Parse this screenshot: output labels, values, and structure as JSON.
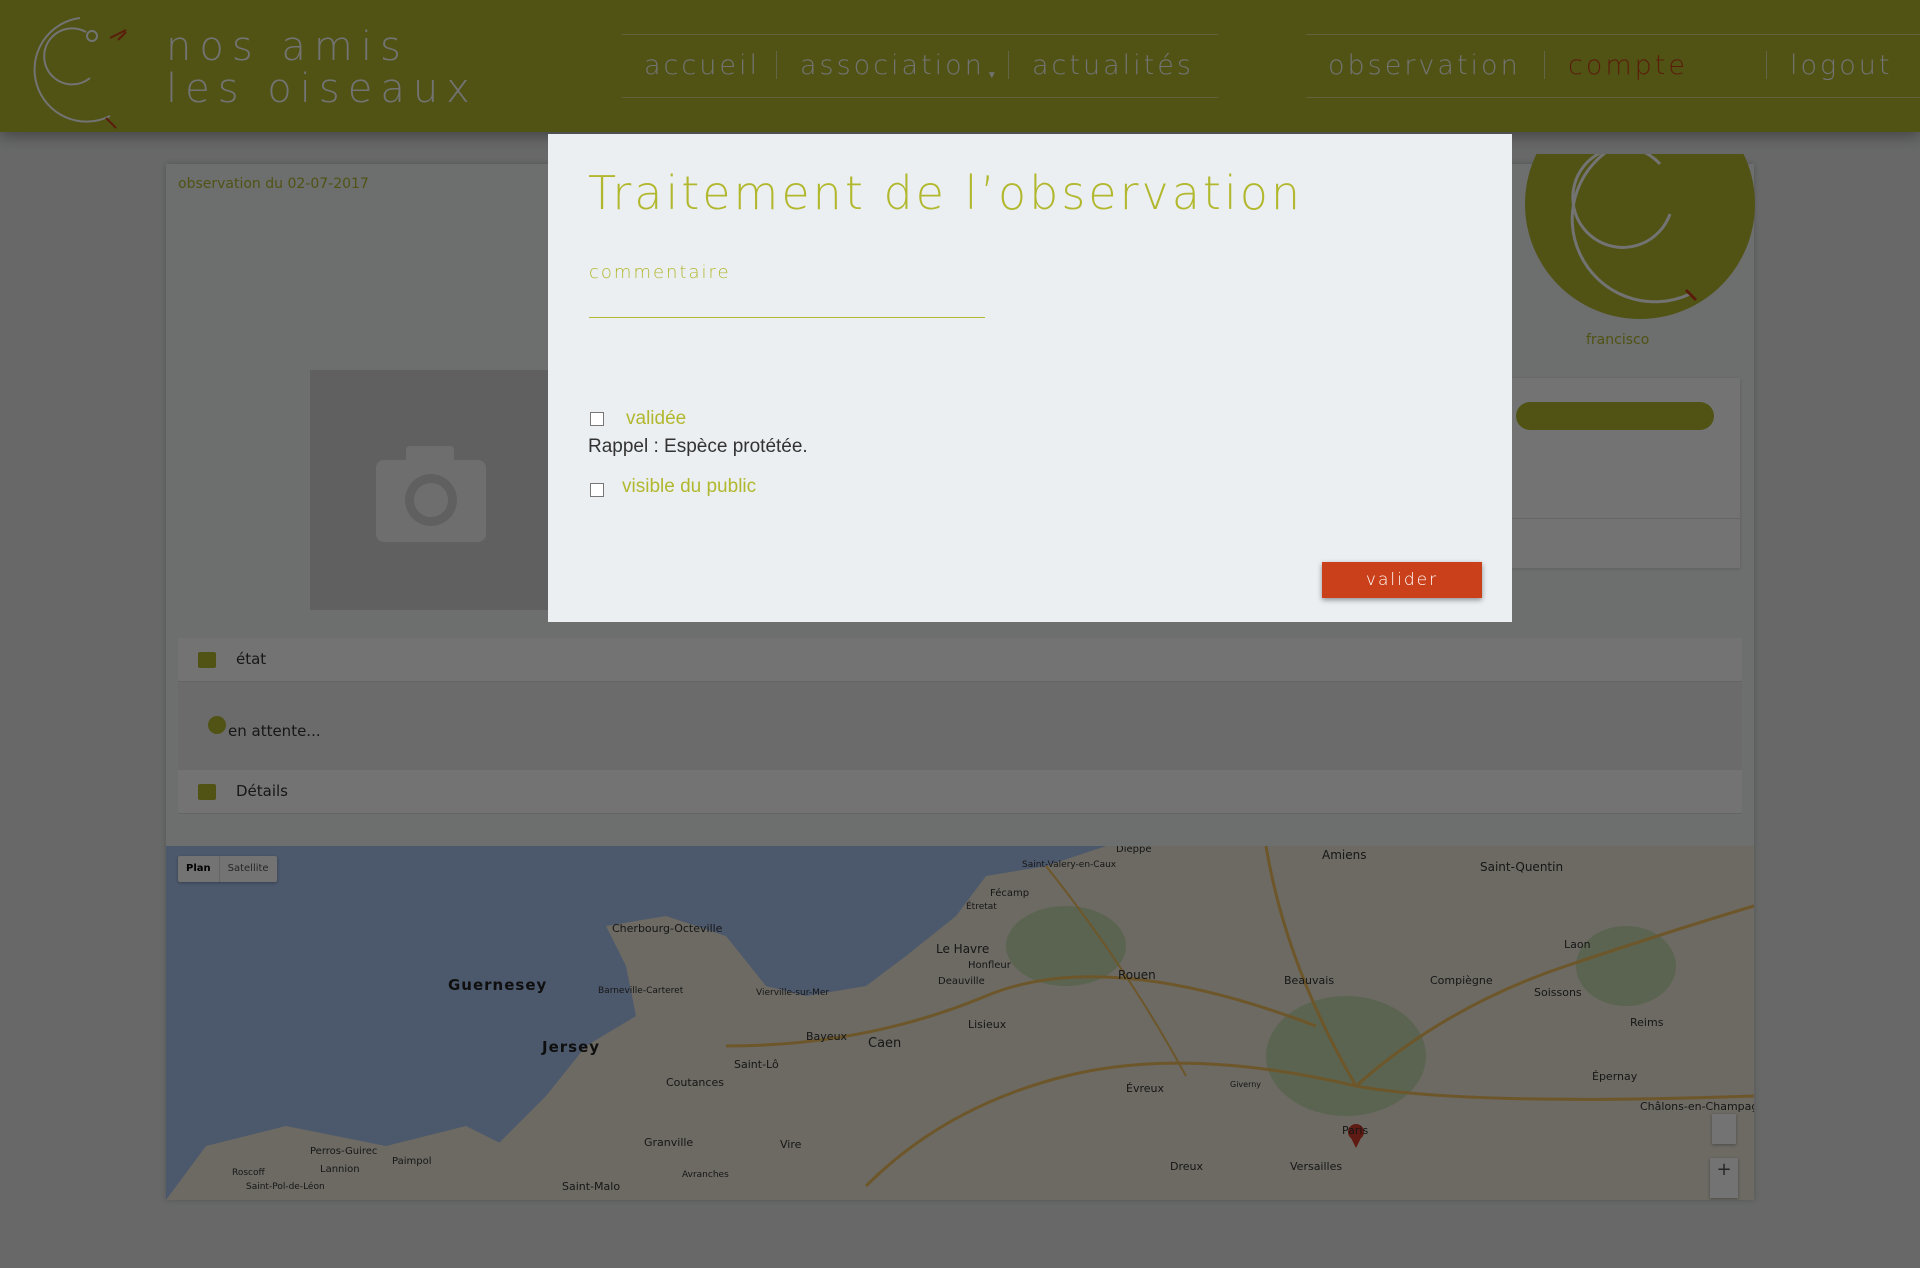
{
  "header": {
    "brand_line1": "nos amis",
    "brand_line2": "les oiseaux",
    "nav_left": [
      {
        "label": "accueil"
      },
      {
        "label": "association"
      },
      {
        "label": "actualités"
      }
    ],
    "nav_right": [
      {
        "label": "observation"
      },
      {
        "label": "compte"
      },
      {
        "label": "logout"
      }
    ]
  },
  "observation": {
    "date_label": "observation du 02-07-2017",
    "username": "francisco",
    "status_section": "état",
    "status_value": "en attente...",
    "details_section": "Détails"
  },
  "map": {
    "type_selected": "Plan",
    "type_other": "Satellite",
    "places": [
      "Guernesey",
      "Jersey",
      "Cherbourg-Octeville",
      "Barneville-Carteret",
      "Vierville-sur-Mer",
      "Bayeux",
      "Caen",
      "Saint-Lô",
      "Coutances",
      "Granville",
      "Avranches",
      "Vire",
      "Saint-Malo",
      "Perros-Guirec",
      "Paimpol",
      "Lannion",
      "Roscoff",
      "Saint-Pol-de-Léon",
      "Dieppe",
      "Saint-Valery-en-Caux",
      "Fécamp",
      "Étretat",
      "Le Havre",
      "Honfleur",
      "Deauville",
      "Lisieux",
      "Rouen",
      "Évreux",
      "Dreux",
      "Versailles",
      "Paris",
      "Beauvais",
      "Compiègne",
      "Soissons",
      "Amiens",
      "Saint-Quentin",
      "Laon",
      "Reims",
      "Épernay",
      "Châlons-en-Champagne",
      "Giverny"
    ]
  },
  "modal": {
    "title": "Traitement de l’observation",
    "comment_label": "commentaire",
    "comment_value": "",
    "validated_label": "validée",
    "reminder": "Rappel : Espèce protétée.",
    "public_label": "visible du public",
    "submit_label": "valider"
  },
  "colors": {
    "brand": "#b2b82e",
    "accent": "#c9401a",
    "modal_bg": "#ebeff2"
  },
  "icons": {
    "logo": "bird-logo-icon",
    "section": "image-icon",
    "status": "clock-icon",
    "camera": "camera-icon"
  }
}
